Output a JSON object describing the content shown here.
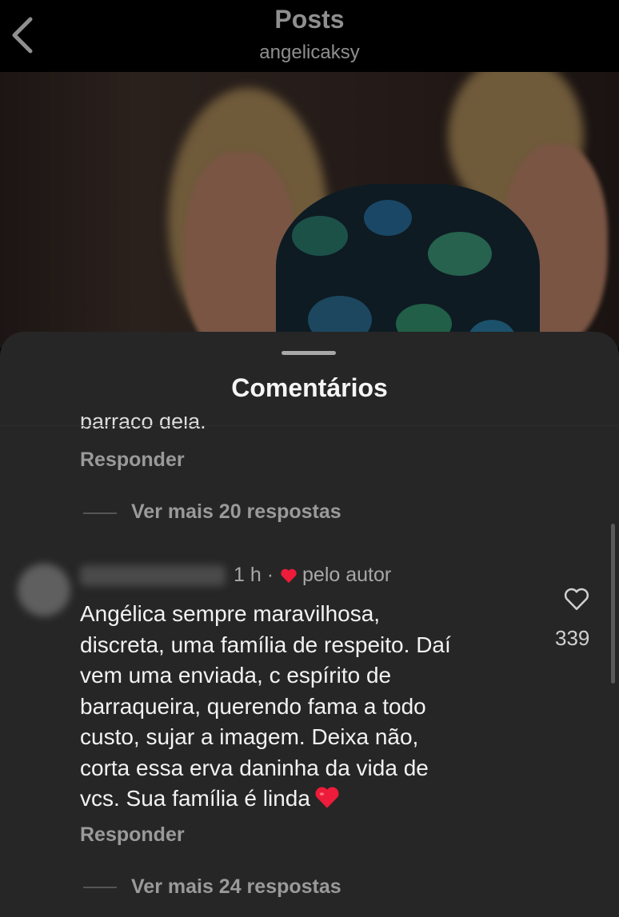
{
  "header": {
    "title": "Posts",
    "username": "angelicaksy"
  },
  "sheet": {
    "title": "Comentários",
    "partial_text": "barraco dela."
  },
  "thread_previous": {
    "reply_label": "Responder",
    "view_more_label": "Ver mais 20 respostas"
  },
  "comment": {
    "time": "1 h ·",
    "liked_by_author": "pelo autor",
    "text_lines": [
      "Angélica sempre maravilhosa,",
      "discreta, uma família de respeito. Daí",
      "vem uma enviada, c espírito de",
      "barraqueira, querendo fama a todo",
      "custo, sujar a imagem. Deixa não,",
      "corta essa erva daninha da vida de",
      "vcs. Sua família é linda"
    ],
    "like_count": "339",
    "reply_label": "Responder",
    "view_more_label": "Ver mais 24 respostas"
  },
  "colors": {
    "heart": "#ed1c3a",
    "sheet_bg": "#262626",
    "muted_text": "#9a9a9a"
  },
  "icons": {
    "back": "chevron-left-icon",
    "like": "heart-outline-icon",
    "author_like": "heart-filled-icon",
    "emoji": "red-heart-emoji"
  }
}
